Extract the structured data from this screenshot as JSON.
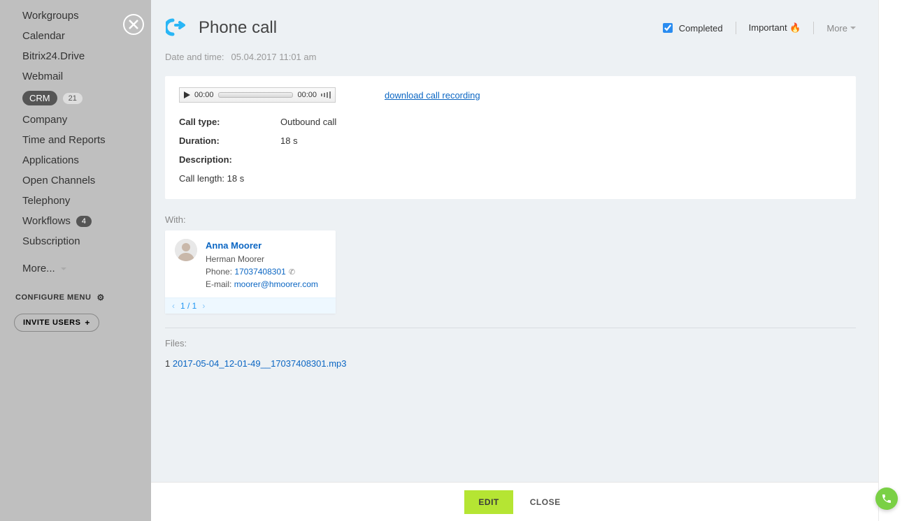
{
  "sidebar": {
    "items": [
      {
        "label": "Workgroups"
      },
      {
        "label": "Calendar"
      },
      {
        "label": "Bitrix24.Drive"
      },
      {
        "label": "Webmail"
      },
      {
        "label": "CRM",
        "badge": "21",
        "active": true
      },
      {
        "label": "Company"
      },
      {
        "label": "Time and Reports"
      },
      {
        "label": "Applications"
      },
      {
        "label": "Open Channels"
      },
      {
        "label": "Telephony"
      },
      {
        "label": "Workflows",
        "badge": "4"
      },
      {
        "label": "Subscription"
      },
      {
        "label": "More..."
      }
    ],
    "configure": "CONFIGURE MENU",
    "invite": "INVITE USERS"
  },
  "header": {
    "title": "Phone call",
    "completed_label": "Completed",
    "completed_checked": true,
    "important_label": "Important",
    "more_label": "More"
  },
  "datetime": {
    "label": "Date and time:",
    "value": "05.04.2017 11:01 am"
  },
  "player": {
    "t1": "00:00",
    "t2": "00:00"
  },
  "download_label": "download call recording",
  "details": {
    "call_type": {
      "k": "Call type:",
      "v": "Outbound call"
    },
    "duration": {
      "k": "Duration:",
      "v": "18 s"
    },
    "description_k": "Description:",
    "description_v": "Call length: 18 s"
  },
  "with_label": "With:",
  "contact": {
    "name": "Anna Moorer",
    "company": "Herman Moorer",
    "phone_label": "Phone:",
    "phone": "17037408301",
    "email_label": "E-mail:",
    "email": "moorer@hmoorer.com",
    "pager": "1 / 1"
  },
  "files": {
    "label": "Files:",
    "idx": "1",
    "name": "2017-05-04_12-01-49__17037408301.mp3"
  },
  "footer": {
    "edit": "EDIT",
    "close": "CLOSE"
  }
}
